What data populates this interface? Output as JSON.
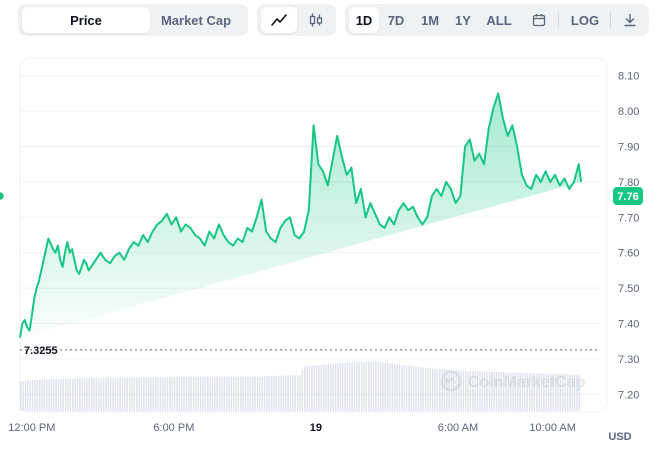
{
  "toolbar": {
    "view_tabs": [
      "Price",
      "Market Cap"
    ],
    "active_view": "Price",
    "chart_types": [
      "line-chart-icon",
      "candlestick-icon"
    ],
    "active_chart_type": "line-chart-icon",
    "ranges": [
      "1D",
      "7D",
      "1M",
      "1Y",
      "ALL"
    ],
    "active_range": "1D",
    "calendar_icon": "calendar-icon",
    "log_label": "LOG",
    "download_icon": "download-icon"
  },
  "watermark": "CoinMarketCap",
  "colors": {
    "line": "#16c784",
    "fill_top": "#16c784",
    "volume": "#cfd6e4",
    "price_badge": "#16c784",
    "grid": "#eff2f5",
    "axis_text": "#58667e"
  },
  "chart_data": {
    "type": "line",
    "currency_label": "USD",
    "current_price_label": "7.76",
    "open_price_label": "7.3255",
    "open_price": 7.3255,
    "ylim": [
      7.15,
      8.15
    ],
    "y_ticks": [
      7.2,
      7.3,
      7.4,
      7.5,
      7.6,
      7.7,
      7.8,
      7.9,
      8.0,
      8.1
    ],
    "y_tick_labels": [
      "7.20",
      "7.30",
      "7.40",
      "7.50",
      "7.60",
      "7.70",
      "7.80",
      "7.90",
      "8.00",
      "8.10"
    ],
    "x_ticks": [
      {
        "label": "12:00 PM",
        "t": 0.5
      },
      {
        "label": "6:00 PM",
        "t": 6.5
      },
      {
        "label": "19",
        "t": 12.5,
        "bold": true
      },
      {
        "label": "6:00 AM",
        "t": 18.5
      },
      {
        "label": "10:00 AM",
        "t": 22.5
      }
    ],
    "xlim": [
      0,
      24.5
    ],
    "series": [
      {
        "values_t": [
          0.0,
          0.1,
          0.2,
          0.3,
          0.4,
          0.5,
          0.6,
          0.7,
          0.8,
          1.0,
          1.2,
          1.4,
          1.5,
          1.6,
          1.7,
          1.8,
          1.9,
          2.0,
          2.1,
          2.2,
          2.3,
          2.4,
          2.5,
          2.6,
          2.7,
          2.8,
          2.9,
          3.0,
          3.2,
          3.4,
          3.6,
          3.8,
          4.0,
          4.2,
          4.4,
          4.6,
          4.8,
          5.0,
          5.2,
          5.4,
          5.6,
          5.8,
          6.0,
          6.2,
          6.4,
          6.6,
          6.8,
          7.0,
          7.2,
          7.4,
          7.6,
          7.8,
          8.0,
          8.2,
          8.4,
          8.6,
          8.8,
          9.0,
          9.2,
          9.4,
          9.6,
          9.8,
          10.0,
          10.2,
          10.4,
          10.6,
          10.8,
          11.0,
          11.2,
          11.4,
          11.6,
          11.8,
          12.0,
          12.2,
          12.4,
          12.6,
          12.8,
          13.0,
          13.2,
          13.4,
          13.6,
          13.8,
          14.0,
          14.2,
          14.4,
          14.6,
          14.8,
          15.0,
          15.2,
          15.4,
          15.6,
          15.8,
          16.0,
          16.2,
          16.4,
          16.6,
          16.8,
          17.0,
          17.2,
          17.4,
          17.6,
          17.8,
          18.0,
          18.2,
          18.4,
          18.6,
          18.8,
          19.0,
          19.2,
          19.4,
          19.6,
          19.8,
          20.0,
          20.2,
          20.4,
          20.6,
          20.8,
          21.0,
          21.2,
          21.4,
          21.6,
          21.8,
          22.0,
          22.2,
          22.4,
          22.6,
          22.8,
          23.0,
          23.2,
          23.4,
          23.6,
          23.7
        ],
        "values": [
          7.36,
          7.4,
          7.41,
          7.39,
          7.38,
          7.42,
          7.47,
          7.5,
          7.52,
          7.58,
          7.64,
          7.61,
          7.6,
          7.62,
          7.58,
          7.56,
          7.6,
          7.63,
          7.6,
          7.61,
          7.58,
          7.55,
          7.54,
          7.56,
          7.58,
          7.57,
          7.55,
          7.56,
          7.58,
          7.6,
          7.58,
          7.57,
          7.59,
          7.6,
          7.58,
          7.61,
          7.63,
          7.62,
          7.65,
          7.63,
          7.66,
          7.68,
          7.69,
          7.71,
          7.68,
          7.7,
          7.66,
          7.68,
          7.67,
          7.65,
          7.64,
          7.62,
          7.66,
          7.64,
          7.68,
          7.65,
          7.63,
          7.62,
          7.64,
          7.63,
          7.67,
          7.66,
          7.7,
          7.75,
          7.66,
          7.64,
          7.63,
          7.67,
          7.69,
          7.7,
          7.65,
          7.64,
          7.66,
          7.72,
          7.96,
          7.85,
          7.83,
          7.79,
          7.86,
          7.93,
          7.87,
          7.82,
          7.84,
          7.74,
          7.78,
          7.7,
          7.74,
          7.71,
          7.68,
          7.67,
          7.7,
          7.68,
          7.72,
          7.74,
          7.72,
          7.73,
          7.7,
          7.68,
          7.7,
          7.76,
          7.78,
          7.76,
          7.8,
          7.78,
          7.74,
          7.76,
          7.9,
          7.92,
          7.86,
          7.88,
          7.85,
          7.95,
          8.01,
          8.05,
          7.98,
          7.93,
          7.96,
          7.9,
          7.82,
          7.79,
          7.78,
          7.82,
          7.8,
          7.83,
          7.8,
          7.82,
          7.79,
          7.81,
          7.78,
          7.8,
          7.85,
          7.8,
          7.79,
          7.81,
          7.79,
          7.82,
          7.81,
          7.78,
          7.74,
          7.72,
          7.74,
          7.76
        ]
      }
    ],
    "volume": {
      "values_t": [
        0.0,
        1.0,
        2.0,
        3.0,
        4.0,
        5.0,
        6.0,
        7.0,
        8.0,
        9.0,
        10.0,
        11.0,
        11.8,
        12.0,
        13.0,
        14.0,
        15.0,
        16.0,
        17.0,
        18.0,
        19.0,
        20.0,
        21.0,
        22.0,
        23.0,
        23.7
      ],
      "values": [
        0.4,
        0.42,
        0.43,
        0.44,
        0.44,
        0.45,
        0.45,
        0.46,
        0.46,
        0.46,
        0.46,
        0.47,
        0.48,
        0.6,
        0.62,
        0.65,
        0.66,
        0.62,
        0.58,
        0.55,
        0.53,
        0.52,
        0.51,
        0.5,
        0.49,
        0.48
      ]
    }
  }
}
